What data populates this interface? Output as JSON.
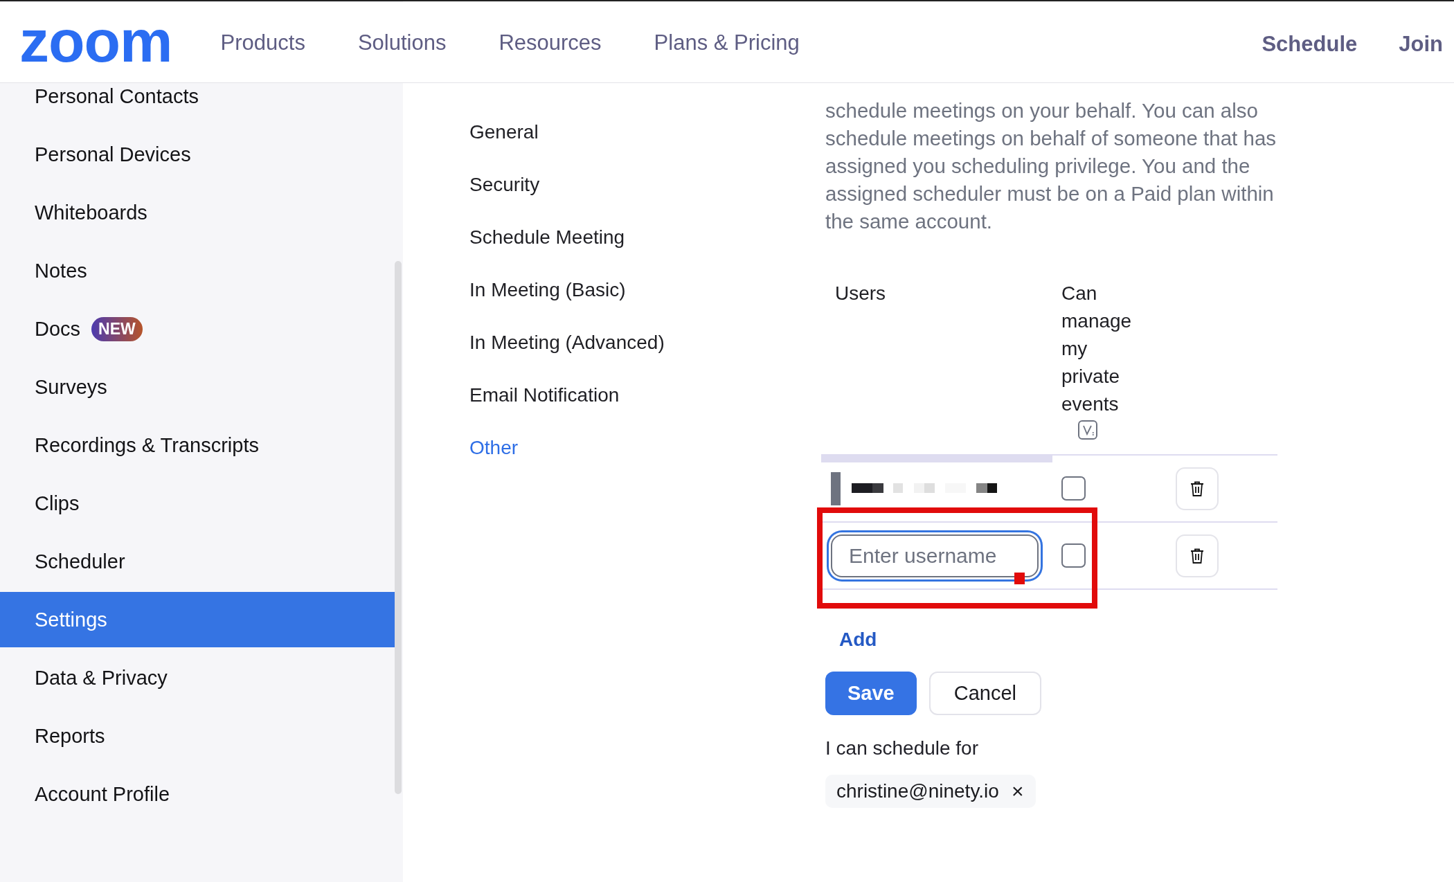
{
  "header": {
    "logo": "zoom",
    "nav": [
      {
        "label": "Products"
      },
      {
        "label": "Solutions"
      },
      {
        "label": "Resources"
      },
      {
        "label": "Plans & Pricing"
      }
    ],
    "actions": [
      {
        "label": "Schedule"
      },
      {
        "label": "Join"
      }
    ]
  },
  "sidebar": {
    "items": [
      {
        "label": "Personal Contacts",
        "selected": false
      },
      {
        "label": "Personal Devices",
        "selected": false
      },
      {
        "label": "Whiteboards",
        "selected": false
      },
      {
        "label": "Notes",
        "selected": false
      },
      {
        "label": "Docs",
        "selected": false,
        "badge": "NEW"
      },
      {
        "label": "Surveys",
        "selected": false
      },
      {
        "label": "Recordings & Transcripts",
        "selected": false
      },
      {
        "label": "Clips",
        "selected": false
      },
      {
        "label": "Scheduler",
        "selected": false
      },
      {
        "label": "Settings",
        "selected": true
      },
      {
        "label": "Data & Privacy",
        "selected": false
      },
      {
        "label": "Reports",
        "selected": false
      },
      {
        "label": "Account Profile",
        "selected": false
      }
    ]
  },
  "settings_nav": {
    "items": [
      {
        "label": "General",
        "selected": false
      },
      {
        "label": "Security",
        "selected": false
      },
      {
        "label": "Schedule Meeting",
        "selected": false
      },
      {
        "label": "In Meeting (Basic)",
        "selected": false
      },
      {
        "label": "In Meeting (Advanced)",
        "selected": false
      },
      {
        "label": "Email Notification",
        "selected": false
      },
      {
        "label": "Other",
        "selected": true
      }
    ]
  },
  "section": {
    "description": "schedule meetings on your behalf. You can also schedule meetings on behalf of someone that has assigned you scheduling privilege. You and the assigned scheduler must be on a Paid plan within the same account.",
    "table": {
      "columns": [
        {
          "label": "Users"
        },
        {
          "label": "Can manage my private events"
        }
      ],
      "rows": [
        {
          "kind": "user",
          "checked": false
        },
        {
          "kind": "input",
          "placeholder": "Enter username",
          "focused": true,
          "checked": false
        }
      ]
    },
    "add_link": "Add",
    "buttons": [
      {
        "label": "Save",
        "kind": "primary"
      },
      {
        "label": "Cancel",
        "kind": "secondary"
      }
    ],
    "schedule_for": {
      "label": "I can schedule for",
      "chips": [
        {
          "label": "christine@ninety.io",
          "remove": "×"
        }
      ]
    }
  }
}
